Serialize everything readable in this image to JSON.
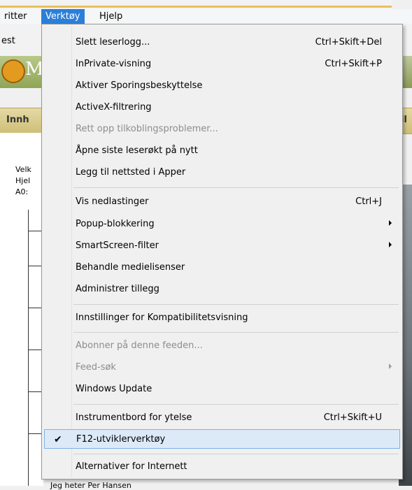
{
  "menubar": {
    "items": [
      {
        "label": "ritter"
      },
      {
        "label": "Verktøy"
      },
      {
        "label": "Hjelp"
      }
    ]
  },
  "background": {
    "fav_text": "est",
    "logo_letter": "M",
    "tab_left": "Innh",
    "tab_right": "il",
    "tree": [
      "Velk",
      "Hjel",
      "A0:"
    ],
    "bottom_text": "Jeg heter Per Hansen"
  },
  "menu": {
    "items": [
      {
        "label": "Slett leserlogg...",
        "shortcut": "Ctrl+Skift+Del"
      },
      {
        "label": "InPrivate-visning",
        "shortcut": "Ctrl+Skift+P"
      },
      {
        "label": "Aktiver Sporingsbeskyttelse"
      },
      {
        "label": "ActiveX-filtrering"
      },
      {
        "label": "Rett opp tilkoblingsproblemer...",
        "disabled": true
      },
      {
        "label": "Åpne siste leserøkt på nytt"
      },
      {
        "label": "Legg til nettsted i Apper"
      },
      {
        "label": "Vis nedlastinger",
        "shortcut": "Ctrl+J"
      },
      {
        "label": "Popup-blokkering",
        "submenu": true
      },
      {
        "label": "SmartScreen-filter",
        "submenu": true
      },
      {
        "label": "Behandle medielisenser"
      },
      {
        "label": "Administrer tillegg"
      },
      {
        "label": "Innstillinger for Kompatibilitetsvisning"
      },
      {
        "label": "Abonner på denne feeden...",
        "disabled": true
      },
      {
        "label": "Feed-søk",
        "disabled": true,
        "submenu": true
      },
      {
        "label": "Windows Update"
      },
      {
        "label": "Instrumentbord for ytelse",
        "shortcut": "Ctrl+Skift+U"
      },
      {
        "label": "F12-utviklerverktøy",
        "checked": true,
        "selected": true
      },
      {
        "label": "Alternativer for Internett"
      }
    ],
    "check_glyph": "✔"
  },
  "colors": {
    "menu_highlight": "#2b7fd8",
    "selection_bg": "#dceaf8",
    "selection_border": "#7fb2e6",
    "disabled_text": "#8d8d8d"
  }
}
